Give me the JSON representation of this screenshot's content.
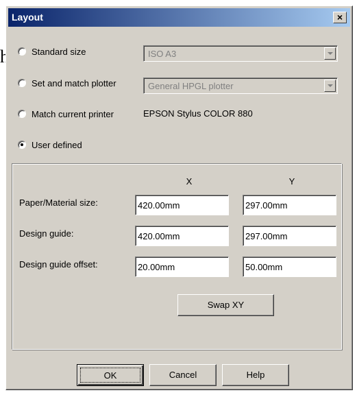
{
  "background_glyph": "h",
  "dialog": {
    "title": "Layout",
    "close_label": "×"
  },
  "options": [
    {
      "label": "Standard size",
      "checked": false
    },
    {
      "label": "Set and match plotter",
      "checked": false
    },
    {
      "label": "Match current printer",
      "checked": false
    },
    {
      "label": "User defined",
      "checked": true
    }
  ],
  "standard_size": {
    "value": "ISO A3"
  },
  "plotter": {
    "value": "General HPGL plotter"
  },
  "current_printer": "EPSON Stylus COLOR 880",
  "columns": {
    "x": "X",
    "y": "Y"
  },
  "rows": [
    {
      "label": "Paper/Material size:",
      "x": "420.00mm",
      "y": "297.00mm"
    },
    {
      "label": "Design guide:",
      "x": "420.00mm",
      "y": "297.00mm"
    },
    {
      "label": "Design guide offset:",
      "x": "20.00mm",
      "y": "50.00mm"
    }
  ],
  "buttons": {
    "swap": "Swap XY",
    "ok": "OK",
    "cancel": "Cancel",
    "help": "Help"
  },
  "colors": {
    "title_bar_start": "#0a246a",
    "title_bar_end": "#a6caf0",
    "face": "#d4d0c8"
  }
}
